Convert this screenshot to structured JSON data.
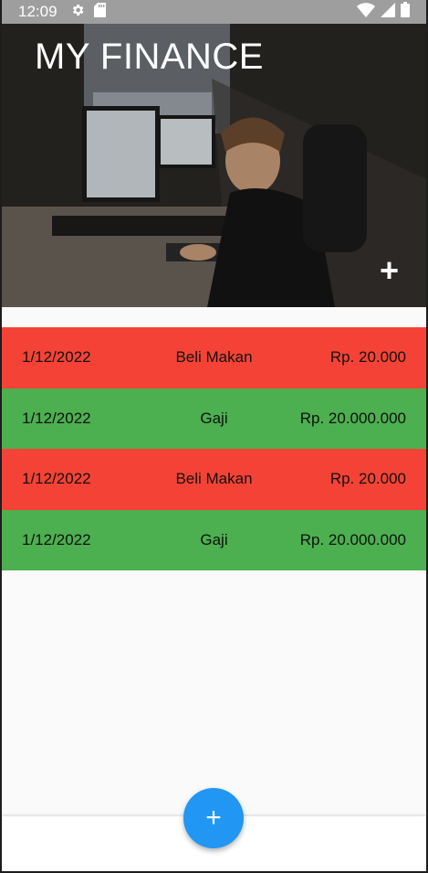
{
  "status_bar": {
    "time": "12:09",
    "icons_left": [
      "gear-icon",
      "sd-card-icon"
    ],
    "icons_right": [
      "wifi-icon",
      "signal-icon",
      "battery-icon"
    ]
  },
  "header": {
    "title": "MY FINANCE",
    "add_glyph": "+"
  },
  "transactions": [
    {
      "date": "1/12/2022",
      "description": "Beli Makan",
      "amount": "Rp. 20.000",
      "type": "expense"
    },
    {
      "date": "1/12/2022",
      "description": "Gaji",
      "amount": "Rp. 20.000.000",
      "type": "income"
    },
    {
      "date": "1/12/2022",
      "description": "Beli Makan",
      "amount": "Rp. 20.000",
      "type": "expense"
    },
    {
      "date": "1/12/2022",
      "description": "Gaji",
      "amount": "Rp. 20.000.000",
      "type": "income"
    }
  ],
  "fab": {
    "glyph": "+"
  },
  "colors": {
    "expense": "#f44336",
    "income": "#4caf50",
    "fab": "#2196f3",
    "status_bar": "#9e9e9e"
  }
}
